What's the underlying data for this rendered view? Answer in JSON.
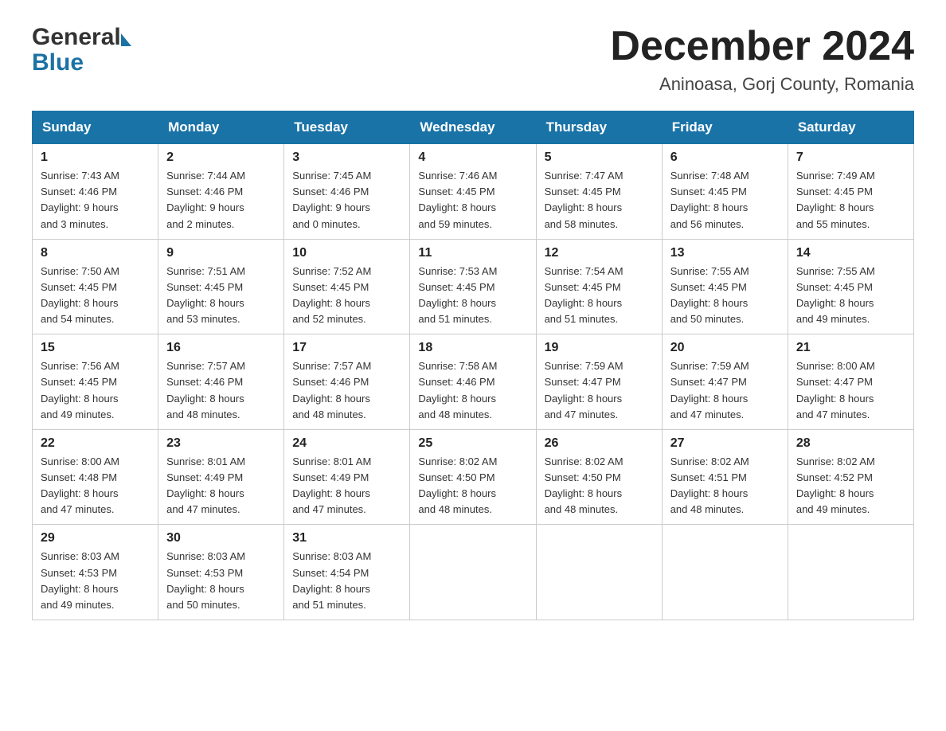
{
  "header": {
    "logo_general": "General",
    "logo_blue": "Blue",
    "month_title": "December 2024",
    "location": "Aninoasa, Gorj County, Romania"
  },
  "days_of_week": [
    "Sunday",
    "Monday",
    "Tuesday",
    "Wednesday",
    "Thursday",
    "Friday",
    "Saturday"
  ],
  "weeks": [
    [
      {
        "day": "1",
        "sunrise": "7:43 AM",
        "sunset": "4:46 PM",
        "daylight": "9 hours and 3 minutes."
      },
      {
        "day": "2",
        "sunrise": "7:44 AM",
        "sunset": "4:46 PM",
        "daylight": "9 hours and 2 minutes."
      },
      {
        "day": "3",
        "sunrise": "7:45 AM",
        "sunset": "4:46 PM",
        "daylight": "9 hours and 0 minutes."
      },
      {
        "day": "4",
        "sunrise": "7:46 AM",
        "sunset": "4:45 PM",
        "daylight": "8 hours and 59 minutes."
      },
      {
        "day": "5",
        "sunrise": "7:47 AM",
        "sunset": "4:45 PM",
        "daylight": "8 hours and 58 minutes."
      },
      {
        "day": "6",
        "sunrise": "7:48 AM",
        "sunset": "4:45 PM",
        "daylight": "8 hours and 56 minutes."
      },
      {
        "day": "7",
        "sunrise": "7:49 AM",
        "sunset": "4:45 PM",
        "daylight": "8 hours and 55 minutes."
      }
    ],
    [
      {
        "day": "8",
        "sunrise": "7:50 AM",
        "sunset": "4:45 PM",
        "daylight": "8 hours and 54 minutes."
      },
      {
        "day": "9",
        "sunrise": "7:51 AM",
        "sunset": "4:45 PM",
        "daylight": "8 hours and 53 minutes."
      },
      {
        "day": "10",
        "sunrise": "7:52 AM",
        "sunset": "4:45 PM",
        "daylight": "8 hours and 52 minutes."
      },
      {
        "day": "11",
        "sunrise": "7:53 AM",
        "sunset": "4:45 PM",
        "daylight": "8 hours and 51 minutes."
      },
      {
        "day": "12",
        "sunrise": "7:54 AM",
        "sunset": "4:45 PM",
        "daylight": "8 hours and 51 minutes."
      },
      {
        "day": "13",
        "sunrise": "7:55 AM",
        "sunset": "4:45 PM",
        "daylight": "8 hours and 50 minutes."
      },
      {
        "day": "14",
        "sunrise": "7:55 AM",
        "sunset": "4:45 PM",
        "daylight": "8 hours and 49 minutes."
      }
    ],
    [
      {
        "day": "15",
        "sunrise": "7:56 AM",
        "sunset": "4:45 PM",
        "daylight": "8 hours and 49 minutes."
      },
      {
        "day": "16",
        "sunrise": "7:57 AM",
        "sunset": "4:46 PM",
        "daylight": "8 hours and 48 minutes."
      },
      {
        "day": "17",
        "sunrise": "7:57 AM",
        "sunset": "4:46 PM",
        "daylight": "8 hours and 48 minutes."
      },
      {
        "day": "18",
        "sunrise": "7:58 AM",
        "sunset": "4:46 PM",
        "daylight": "8 hours and 48 minutes."
      },
      {
        "day": "19",
        "sunrise": "7:59 AM",
        "sunset": "4:47 PM",
        "daylight": "8 hours and 47 minutes."
      },
      {
        "day": "20",
        "sunrise": "7:59 AM",
        "sunset": "4:47 PM",
        "daylight": "8 hours and 47 minutes."
      },
      {
        "day": "21",
        "sunrise": "8:00 AM",
        "sunset": "4:47 PM",
        "daylight": "8 hours and 47 minutes."
      }
    ],
    [
      {
        "day": "22",
        "sunrise": "8:00 AM",
        "sunset": "4:48 PM",
        "daylight": "8 hours and 47 minutes."
      },
      {
        "day": "23",
        "sunrise": "8:01 AM",
        "sunset": "4:49 PM",
        "daylight": "8 hours and 47 minutes."
      },
      {
        "day": "24",
        "sunrise": "8:01 AM",
        "sunset": "4:49 PM",
        "daylight": "8 hours and 47 minutes."
      },
      {
        "day": "25",
        "sunrise": "8:02 AM",
        "sunset": "4:50 PM",
        "daylight": "8 hours and 48 minutes."
      },
      {
        "day": "26",
        "sunrise": "8:02 AM",
        "sunset": "4:50 PM",
        "daylight": "8 hours and 48 minutes."
      },
      {
        "day": "27",
        "sunrise": "8:02 AM",
        "sunset": "4:51 PM",
        "daylight": "8 hours and 48 minutes."
      },
      {
        "day": "28",
        "sunrise": "8:02 AM",
        "sunset": "4:52 PM",
        "daylight": "8 hours and 49 minutes."
      }
    ],
    [
      {
        "day": "29",
        "sunrise": "8:03 AM",
        "sunset": "4:53 PM",
        "daylight": "8 hours and 49 minutes."
      },
      {
        "day": "30",
        "sunrise": "8:03 AM",
        "sunset": "4:53 PM",
        "daylight": "8 hours and 50 minutes."
      },
      {
        "day": "31",
        "sunrise": "8:03 AM",
        "sunset": "4:54 PM",
        "daylight": "8 hours and 51 minutes."
      },
      null,
      null,
      null,
      null
    ]
  ],
  "labels": {
    "sunrise_prefix": "Sunrise: ",
    "sunset_prefix": "Sunset: ",
    "daylight_prefix": "Daylight: "
  }
}
